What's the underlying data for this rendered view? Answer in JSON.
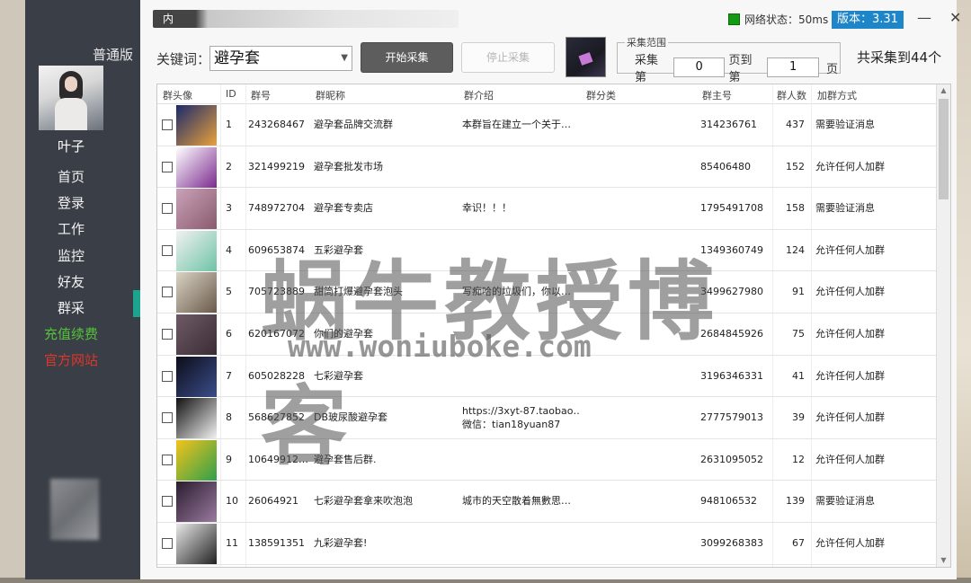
{
  "sidebar": {
    "edition": "普通版",
    "username": "叶子",
    "items": [
      {
        "label": "首页",
        "style": "normal"
      },
      {
        "label": "登录",
        "style": "normal"
      },
      {
        "label": "工作",
        "style": "normal"
      },
      {
        "label": "监控",
        "style": "normal"
      },
      {
        "label": "好友",
        "style": "normal"
      },
      {
        "label": "群采",
        "style": "active"
      },
      {
        "label": "充值续费",
        "style": "green"
      },
      {
        "label": "官方网站",
        "style": "red"
      }
    ]
  },
  "titlebar": {
    "tag": "内",
    "network_status": "网络状态：50ms",
    "version": "版本：3.31",
    "minimize": "—",
    "close": "✕"
  },
  "toolbar": {
    "keyword_label": "关键词：",
    "keyword_value": "避孕套",
    "start_label": "开始采集",
    "stop_label": "停止采集",
    "range_legend": "采集范围",
    "range_from_label": "采集第",
    "range_from_value": "0",
    "range_to_label": "页到第",
    "range_to_value": "1",
    "range_unit": "页",
    "total_text": "共采集到44个"
  },
  "table": {
    "headers": [
      "群头像",
      "ID",
      "群号",
      "群昵称",
      "群介绍",
      "群分类",
      "群主号",
      "群人数",
      "加群方式"
    ],
    "rows": [
      {
        "id": "1",
        "num": "243268467",
        "name": "避孕套品牌交流群",
        "intro": "本群旨在建立一个关于…",
        "intro2": "",
        "owner": "314236761",
        "count": "437",
        "method": "需要验证消息",
        "color1": "#1b2a6b",
        "color2": "#e9a13b"
      },
      {
        "id": "2",
        "num": "321499219",
        "name": "避孕套批发市场",
        "intro": "",
        "intro2": "",
        "owner": "85406480",
        "count": "152",
        "method": "允许任何人加群",
        "color1": "#ffffff",
        "color2": "#7b2a8f"
      },
      {
        "id": "3",
        "num": "748972704",
        "name": "避孕套专卖店",
        "intro": "幸识！！！",
        "intro2": "",
        "owner": "1795491708",
        "count": "158",
        "method": "需要验证消息",
        "color1": "#c9a2b8",
        "color2": "#8a5a6e"
      },
      {
        "id": "4",
        "num": "609653874",
        "name": "五彩避孕套",
        "intro": "",
        "intro2": "",
        "owner": "1349360749",
        "count": "124",
        "method": "允许任何人加群",
        "color1": "#f1f1f1",
        "color2": "#6fc3a6"
      },
      {
        "id": "5",
        "num": "705723889",
        "name": "甜筒打爆避孕套泡头",
        "intro": "写痴哈的垃圾们，你以…",
        "intro2": "",
        "owner": "3499627980",
        "count": "91",
        "method": "允许任何人加群",
        "color1": "#d8d3c4",
        "color2": "#6b5a4b"
      },
      {
        "id": "6",
        "num": "620167072",
        "name": "你们的避孕套",
        "intro": "",
        "intro2": "",
        "owner": "2684845926",
        "count": "75",
        "method": "允许任何人加群",
        "color1": "#6e5a66",
        "color2": "#3a2c34"
      },
      {
        "id": "7",
        "num": "605028228",
        "name": "七彩避孕套",
        "intro": "",
        "intro2": "",
        "owner": "3196346331",
        "count": "41",
        "method": "允许任何人加群",
        "color1": "#0d0d1a",
        "color2": "#3b4e8a"
      },
      {
        "id": "8",
        "num": "568627852",
        "name": "DB玻尿酸避孕套",
        "intro": "https://3xyt-87.taobao…",
        "intro2": "微信：tian18yuan87",
        "owner": "2777579013",
        "count": "39",
        "method": "允许任何人加群",
        "color1": "#111111",
        "color2": "#f2f2f2"
      },
      {
        "id": "9",
        "num": "10649912…",
        "name": "避孕套售后群.",
        "intro": "",
        "intro2": "",
        "owner": "2631095052",
        "count": "12",
        "method": "允许任何人加群",
        "color1": "#f4c31c",
        "color2": "#2ea04a"
      },
      {
        "id": "10",
        "num": "26064921",
        "name": "七彩避孕套拿来吹泡泡",
        "intro": "城市的天空散着無數思…",
        "intro2": "",
        "owner": "948106532",
        "count": "139",
        "method": "需要验证消息",
        "color1": "#2a1c2e",
        "color2": "#9a7aa0"
      },
      {
        "id": "11",
        "num": "138591351",
        "name": "九彩避孕套!",
        "intro": "",
        "intro2": "",
        "owner": "3099268383",
        "count": "67",
        "method": "允许任何人加群",
        "color1": "#e8e8e8",
        "color2": "#222222"
      }
    ]
  },
  "watermark": {
    "title": "蜗牛教授博客",
    "url": "www.woniuboke.com"
  }
}
